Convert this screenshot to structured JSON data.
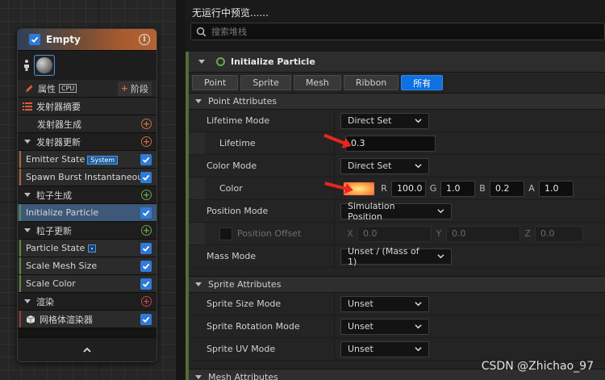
{
  "node": {
    "title": "Empty",
    "properties_label": "属性",
    "cpu_label": "CPU",
    "stage_label": "阶段",
    "summary_label": "发射器摘要",
    "rows": [
      {
        "label": "发射器生成",
        "kind": "sub-add",
        "color": "orange"
      },
      {
        "label": "发射器更新",
        "kind": "section",
        "color": "orange"
      },
      {
        "label": "Emitter State",
        "badge": "System",
        "kind": "item",
        "color": "orange"
      },
      {
        "label": "Spawn Burst Instantaneous",
        "kind": "item",
        "color": "orange"
      },
      {
        "label": "粒子生成",
        "kind": "section",
        "color": "green"
      },
      {
        "label": "Initialize Particle",
        "kind": "item",
        "color": "green",
        "selected": true
      },
      {
        "label": "粒子更新",
        "kind": "section",
        "color": "green"
      },
      {
        "label": "Particle State",
        "kind": "item",
        "color": "green",
        "mini_badge": true
      },
      {
        "label": "Scale Mesh Size",
        "kind": "item",
        "color": "green"
      },
      {
        "label": "Scale Color",
        "kind": "item",
        "color": "green"
      },
      {
        "label": "渲染",
        "kind": "section",
        "color": "red"
      },
      {
        "label": "网格体渲染器",
        "kind": "item",
        "color": "red",
        "mesh_icon": true
      }
    ]
  },
  "panel": {
    "title": "无运行中预览......",
    "search_placeholder": "搜索堆栈",
    "module_title": "Initialize Particle",
    "filters": [
      {
        "label": "Point",
        "active": false
      },
      {
        "label": "Sprite",
        "active": false
      },
      {
        "label": "Mesh",
        "active": false
      },
      {
        "label": "Ribbon",
        "active": false
      },
      {
        "label": "所有",
        "active": true
      }
    ],
    "point_section": "Point Attributes",
    "lifetime_mode_label": "Lifetime Mode",
    "lifetime_mode_value": "Direct Set",
    "lifetime_label": "Lifetime",
    "lifetime_value": "0.3",
    "color_mode_label": "Color Mode",
    "color_mode_value": "Direct Set",
    "color_label": "Color",
    "color": {
      "r_label": "R",
      "r": "100.0",
      "g_label": "G",
      "g": "1.0",
      "b_label": "B",
      "b": "0.2",
      "a_label": "A",
      "a": "1.0"
    },
    "position_mode_label": "Position Mode",
    "position_mode_value": "Simulation Position",
    "position_offset_label": "Position Offset",
    "offset": {
      "x_label": "X",
      "x": "0.0",
      "y_label": "Y",
      "y": "0.0",
      "z_label": "Z",
      "z": "0.0"
    },
    "mass_mode_label": "Mass Mode",
    "mass_mode_value": "Unset / (Mass of 1)",
    "sprite_section": "Sprite Attributes",
    "sprite_size_label": "Sprite Size Mode",
    "sprite_size_value": "Unset",
    "sprite_rot_label": "Sprite Rotation Mode",
    "sprite_rot_value": "Unset",
    "sprite_uv_label": "Sprite UV Mode",
    "sprite_uv_value": "Unset",
    "mesh_section": "Mesh Attributes"
  },
  "watermark": "CSDN @Zhichao_97",
  "colors": {
    "accent": "#0f70e0",
    "selected_row": "#3d5878",
    "swatch": "#ff9a4a",
    "arrow": "#e8261c"
  }
}
